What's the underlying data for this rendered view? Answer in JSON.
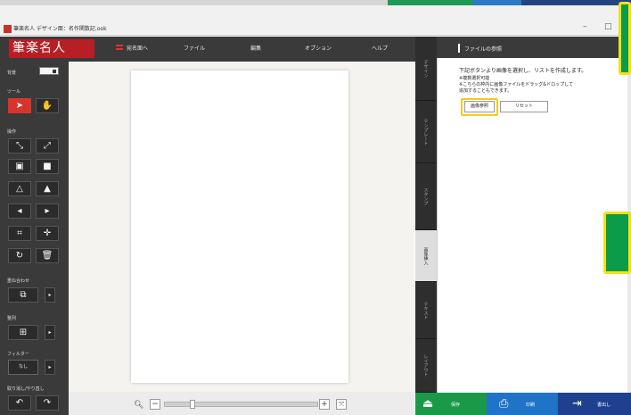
{
  "window": {
    "title": "筆楽名人 デザイン面：名作関数記.ook",
    "minimize_glyph": "–",
    "maximize_glyph": "□"
  },
  "app": {
    "logo_text": "筆楽名人"
  },
  "menu": {
    "items": [
      {
        "label": "宛名面へ"
      },
      {
        "label": "ファイル"
      },
      {
        "label": "編集"
      },
      {
        "label": "オプション"
      },
      {
        "label": "ヘルプ"
      }
    ]
  },
  "tools": {
    "view_label": "背景",
    "tool_section": "ツール",
    "edit_section": "操作",
    "layer_section": "重ね合わせ",
    "align_section": "整列",
    "filter_section": "フィルター",
    "filter_value": "なし",
    "undo_section": "取り消し/やり直し",
    "more_glyph": "▸"
  },
  "side_tabs": [
    {
      "label": "デザイン"
    },
    {
      "label": "テンプレート"
    },
    {
      "label": "スタンプ"
    },
    {
      "label": "画像挿入"
    },
    {
      "label": "テキスト"
    },
    {
      "label": "レイアウト"
    }
  ],
  "right_panel": {
    "title": "ファイルの参照",
    "heading": "下記ボタンより画像を選択し、リストを作成します。",
    "note1": "※複数選択可能",
    "note2": "※こちらの枠内に画像ファイルをドラッグ&ドロップして",
    "note3": "追加することもできます。",
    "select_button": "画像参照",
    "reset_button": "リセット"
  },
  "footer": {
    "save_label": "保存",
    "print_label": "印刷",
    "export_label": "書出し"
  },
  "colors": {
    "accent_red": "#b81f24",
    "highlight_yellow": "#f2cc1a",
    "save_green": "#1a9a48",
    "print_blue": "#1f74c7",
    "export_navy": "#1f3f8f"
  }
}
